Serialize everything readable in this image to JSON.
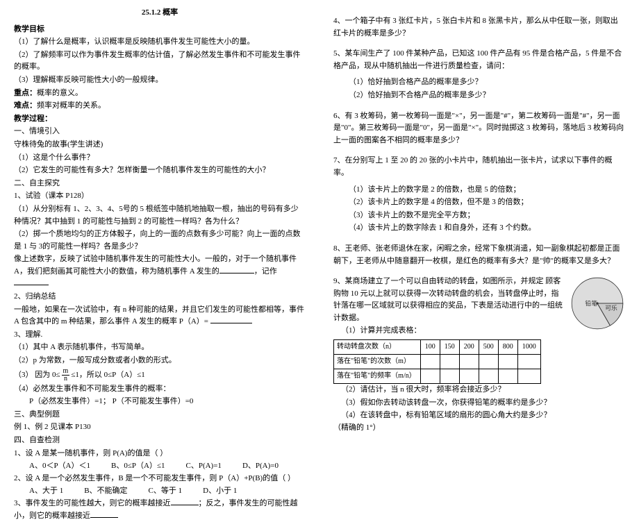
{
  "title": "25.1.2 概率",
  "left": {
    "objectives_head": "教学目标",
    "obj1": "（1）了解什么是概率，认识概率是反映随机事件发生可能性大小的量。",
    "obj2": "（2）了解频率可以作为事件发生概率的估计值，了解必然发生事件和不可能发生事件的概率。",
    "obj3": "（3）理解概率反映可能性大小的一般规律。",
    "keypoint": "重点：概率的意义。",
    "difficulty": "难点：频率对概率的关系。",
    "process_head": "教学过程：",
    "s1": "一、情境引入",
    "s1a": "守株待兔的故事(学生讲述)",
    "s1b": "（1）这是个什么事件？",
    "s1c": "（2）它发生的可能性有多大？怎样衡量一个随机事件发生的可能性的大小？",
    "s2": "二、自主探究",
    "s2a": "1、试验（课本 P128）",
    "s2b": "（1）从分别标有 1、2、3、4、5号的 5 根纸签中随机地抽取一根，抽出的号码有多少种情况？其中抽到 1 的可能性与抽到 2 的可能性一样吗？各为什么？",
    "s2c": "（2）掷一个质地均匀的正方体骰子，向上的一面的点数有多少可能？向上一面的点数是 1 与 3的可能性一样吗？各是多少？",
    "s2d": "像上述数字，反映了试验中随机事件发生的可能性大小。一般的，对于一个随机事件 A，我们把刻画其可能性大小的数值，称为随机事件 A 发生的________，记作________",
    "s3": "2、归纳总结",
    "s3a": "一般地，如果在一次试验中，有 n 种可能的结果，并且它们发生的可能性都相等，事件 A 包含其中的 m 种结果，那么事件 A 发生的概率 P（A）= ",
    "s4": "3、理解.",
    "s4a": "（1）其中 A 表示随机事件，书写简单。",
    "s4b": "（2）p 为常数，一般写成分数或者小数的形式。",
    "s4c_pre": "（3） 因为 0≤",
    "s4c_post": "≤1，所以 0≤P（A）≤1",
    "s4d": "（4）必然发生事件和不可能发生事件的概率：",
    "s4e": "P（必然发生事件）=1；     P（不可能发生事件）=0",
    "s5": "三、典型例题",
    "s5a": "  例 1、例 2 见课本 P130",
    "s6": "四、自查检测",
    "q1": "1、设 A 是某一随机事件，则 P(A)的值是（    ）",
    "q1a": "A、0＜P（A）＜1",
    "q1b": "B、0≤P（A）≤1",
    "q1c": "C、P(A)=1",
    "q1d": "D、P(A)=0",
    "q2": "2、设 A 是一个必然发生事件，B 是一个不可能发生事件，则 P（A）+P(B)的值（    ）",
    "q2a": "A、大于 1",
    "q2b": "B、不能确定",
    "q2c": "C、等于 1",
    "q2d": "D、小于 1",
    "q3a": "3、事件发生的可能性越大，则它的概率越接近______；反之，事件发生的可能性越小，则它的概率越接近______"
  },
  "right": {
    "q4": "4、一个箱子中有 3 张红卡片，5 张白卡片和 8 张黑卡片，那么从中任取一张，则取出红卡片的概率是多少？",
    "q5": "5、某车间生产了 100 件某种产品，已知这 100 件产品有 95 件是合格产品，5 件是不合格产品，现从中随机抽出一件进行质量检查，请问：",
    "q5a": "（1）恰好抽到合格产品的概率是多少？",
    "q5b": "（2）恰好抽到不合格产品的概率是多少？",
    "q6": "6、有 3 枚筹码，第一枚筹码一面是\"×\"，另一面是\"#\"，第二枚筹码一面是\"#\"，另一面是\"0\"。第三枚筹码一面是\"0\"，另一面是\"×\"。同时抛掷这 3 枚筹码，落地后 3 枚筹码向上一面的图案各不相同的概率是多少？",
    "q7": "7、在分别写上 1 至 20 的 20 张的小卡片中，随机抽出一张卡片，试求以下事件的概率。",
    "q7a": "（1）该卡片上的数字是 2 的倍数，也是 5 的倍数；",
    "q7b": "（2）该卡片上的数字是 4 的倍数，但不是 3 的倍数；",
    "q7c": "（3）该卡片上的数不是完全平方数；",
    "q7d": "（4）该卡片上的数字除去 1 和自身外，还有 3 个约数。",
    "q8": "8、王老师、张老师退休在家，闲暇之余，经常下象棋消遣，知一副象棋起初都是正面朝下，王老师从中随意翻开一枚棋，是红色的概率有多大？是\"帅\"的概率又是多大？",
    "q9a": "9、某商场建立了一个可以自由转动的转盘，如图所示，并规定 顾客购物 10 元以上就可以获得一次转动转盘的机会，当转盘停止时，指针落在哪一区域就可以获得相应的奖品，下表是活动进行中的一组统计数据。",
    "t_head": "（1）计算并完成表格：",
    "th1": "转动转盘次数（n）",
    "th2": "落在\"铅笔\"的次数（m）",
    "th3": "落在\"铅笔\"的频率（m/n）",
    "c1": "100",
    "c2": "150",
    "c3": "200",
    "c4": "500",
    "c5": "800",
    "c6": "1000",
    "t2": "（2）请估计，当 n 很大时，频率将会接近多少？",
    "t3": "（3）假如你去转动该转盘一次，你获得铅笔的概率约是多少？",
    "t4": "（4）在该转盘中，标有铅笔区域的扇形的圆心角大约是多少？（精确的 1°）",
    "wheel_l1": "铅笔",
    "wheel_l2": "可乐"
  }
}
